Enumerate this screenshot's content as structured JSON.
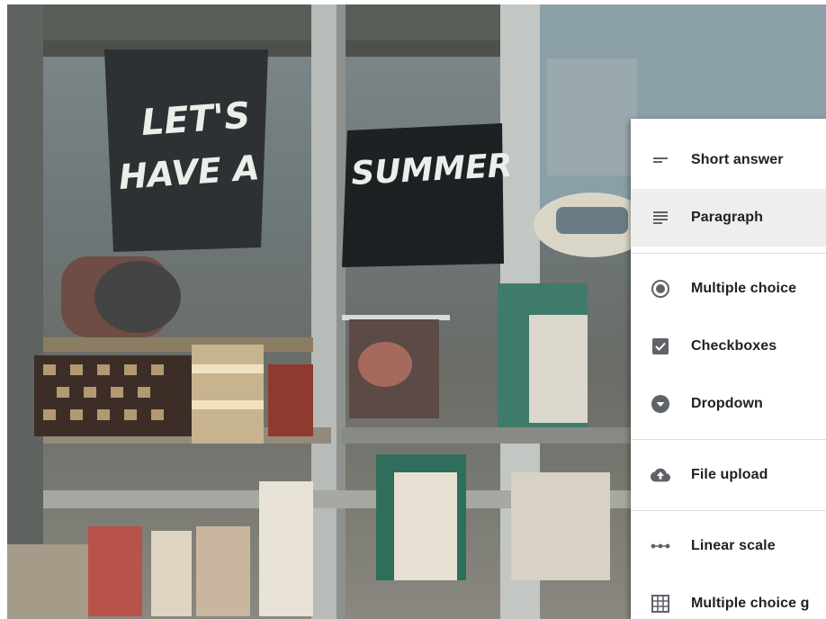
{
  "background": {
    "sign_left": [
      "LET'S",
      "HAVE A"
    ],
    "sign_middle": [
      "SUMMER"
    ]
  },
  "menu": {
    "groups": [
      [
        {
          "label": "Short answer",
          "icon": "short-answer-icon"
        },
        {
          "label": "Paragraph",
          "icon": "paragraph-icon",
          "selected": true
        }
      ],
      [
        {
          "label": "Multiple choice",
          "icon": "radio-icon"
        },
        {
          "label": "Checkboxes",
          "icon": "checkbox-icon"
        },
        {
          "label": "Dropdown",
          "icon": "dropdown-icon"
        }
      ],
      [
        {
          "label": "File upload",
          "icon": "cloud-upload-icon"
        }
      ],
      [
        {
          "label": "Linear scale",
          "icon": "linear-scale-icon"
        },
        {
          "label": "Multiple choice g",
          "icon": "grid-icon"
        }
      ]
    ]
  },
  "colors": {
    "icon": "#5f6368",
    "text": "#202124",
    "selected_bg": "#eeeeee"
  }
}
